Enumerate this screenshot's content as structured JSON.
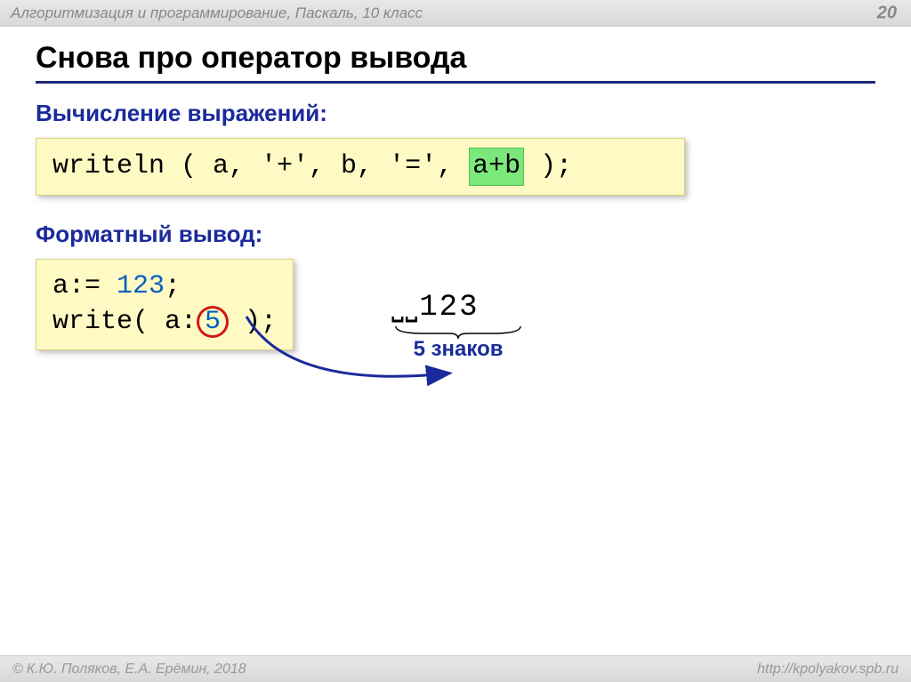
{
  "header": {
    "course": "Алгоритмизация и программирование, Паскаль, 10 класс",
    "page": "20"
  },
  "title": "Снова про оператор вывода",
  "sections": {
    "expr_label": "Вычисление выражений:",
    "fmt_label": "Форматный вывод:"
  },
  "code1": {
    "pre": "writeln ( a, '+', b, '=', ",
    "hl": "a+b",
    "post": " );"
  },
  "code2": {
    "line1_pre": "a:= ",
    "line1_num": "123",
    "line1_post": ";",
    "line2_pre": "write( a:",
    "line2_circ": "5",
    "line2_post": " );"
  },
  "output": {
    "spaces": "⎵⎵",
    "value": "123",
    "brace_label": "5 знаков"
  },
  "footer": {
    "copyright": "К.Ю. Поляков, Е.А. Ерёмин, 2018",
    "url": "http://kpolyakov.spb.ru"
  }
}
